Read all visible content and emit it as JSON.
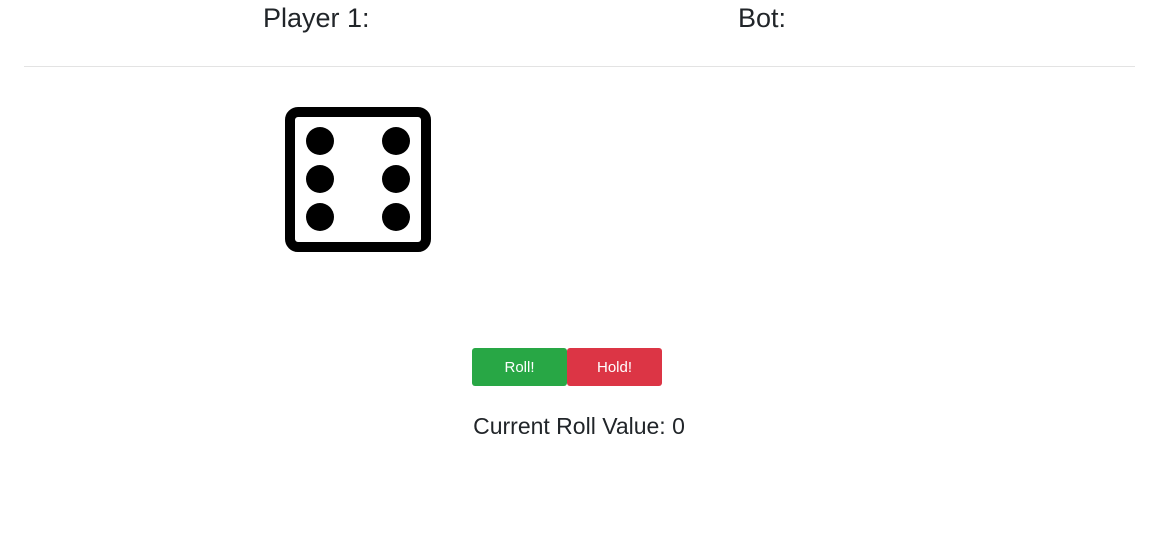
{
  "scores": {
    "player_label": "Player 1:",
    "bot_label": "Bot:"
  },
  "die": {
    "face_value": 6,
    "icon": "dice-six-icon"
  },
  "controls": {
    "roll_label": "Roll!",
    "hold_label": "Hold!",
    "roll_color": "#28a745",
    "hold_color": "#dc3545"
  },
  "current_roll": {
    "text": "Current Roll Value: 0"
  }
}
